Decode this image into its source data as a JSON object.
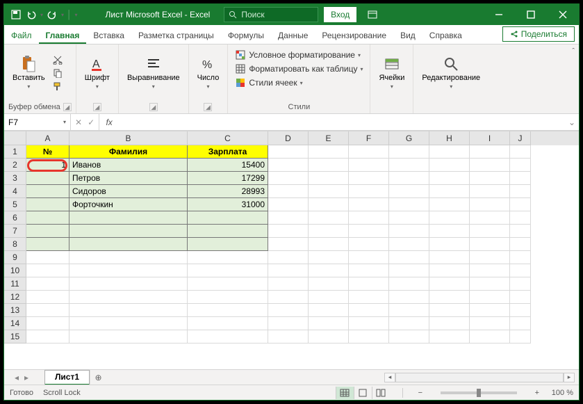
{
  "titlebar": {
    "title": "Лист Microsoft Excel  -  Excel",
    "search_placeholder": "Поиск",
    "login": "Вход"
  },
  "tabs": {
    "file": "Файл",
    "home": "Главная",
    "insert": "Вставка",
    "page_layout": "Разметка страницы",
    "formulas": "Формулы",
    "data": "Данные",
    "review": "Рецензирование",
    "view": "Вид",
    "help": "Справка",
    "share": "Поделиться"
  },
  "ribbon": {
    "clipboard": {
      "paste": "Вставить",
      "label": "Буфер обмена"
    },
    "font": {
      "label": "Шрифт"
    },
    "alignment": {
      "label": "Выравнивание"
    },
    "number": {
      "label": "Число"
    },
    "styles": {
      "cond_format": "Условное форматирование",
      "format_table": "Форматировать как таблицу",
      "cell_styles": "Стили ячеек",
      "label": "Стили"
    },
    "cells": {
      "label": "Ячейки"
    },
    "editing": {
      "label": "Редактирование"
    }
  },
  "namebox": "F7",
  "columns": [
    "A",
    "B",
    "C",
    "D",
    "E",
    "F",
    "G",
    "H",
    "I",
    "J"
  ],
  "row_numbers": [
    "1",
    "2",
    "3",
    "4",
    "5",
    "6",
    "7",
    "8",
    "9",
    "10",
    "11",
    "12",
    "13",
    "14",
    "15"
  ],
  "table": {
    "headers": {
      "num": "№",
      "name": "Фамилия",
      "salary": "Зарплата"
    },
    "rows": [
      {
        "num": "1",
        "name": "Иванов",
        "salary": "15400"
      },
      {
        "num": "",
        "name": "Петров",
        "salary": "17299"
      },
      {
        "num": "",
        "name": "Сидоров",
        "salary": "28993"
      },
      {
        "num": "",
        "name": "Форточкин",
        "salary": "31000"
      },
      {
        "num": "",
        "name": "",
        "salary": ""
      },
      {
        "num": "",
        "name": "",
        "salary": ""
      },
      {
        "num": "",
        "name": "",
        "salary": ""
      }
    ]
  },
  "sheet_tab": "Лист1",
  "statusbar": {
    "ready": "Готово",
    "scroll_lock": "Scroll Lock",
    "zoom": "100 %"
  },
  "colors": {
    "accent": "#197b30",
    "header_fill": "#ffff00",
    "body_fill": "#e2efda",
    "highlight": "#e7352c"
  }
}
